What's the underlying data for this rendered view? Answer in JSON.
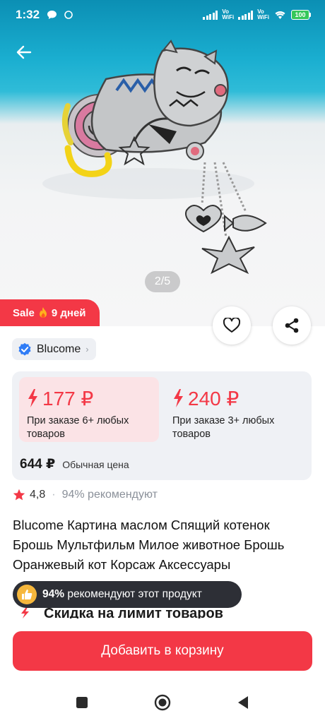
{
  "status": {
    "time": "1:32",
    "vowifi_top": "Vo",
    "vowifi_bottom": "WiFi",
    "battery": "100"
  },
  "gallery": {
    "pager": "2/5"
  },
  "sale": {
    "label": "Sale",
    "days": "9 дней"
  },
  "seller": {
    "name": "Blucome"
  },
  "prices": {
    "option1": {
      "price": "177 ₽",
      "note": "При заказе 6+ любых товаров"
    },
    "option2": {
      "price": "240 ₽",
      "note": "При заказе 3+ любых товаров"
    },
    "regular_amount": "644 ₽",
    "regular_label": "Обычная цена"
  },
  "rating": {
    "score": "4,8",
    "recommend": "94% рекомендуют"
  },
  "product": {
    "title": "Blucome Картина маслом Спящий котенок Брошь Мультфильм Милое животное Брошь Оранжевый кот Корсаж Аксессуары"
  },
  "recommend_pill": {
    "percent": "94%",
    "text": "рекомендуют этот продукт"
  },
  "hidden_section": {
    "title": "Скидка на лимит товаров"
  },
  "cta": {
    "label": "Добавить в корзину"
  },
  "colors": {
    "accent": "#f33846",
    "price_highlight_bg": "#fbe3e6",
    "card_bg": "#eff1f5",
    "pill_bg": "#2d2f36",
    "verified": "#2f7cf6"
  },
  "icons": {
    "back": "arrow-left-icon",
    "favorite": "heart-outline-icon",
    "share": "share-icon",
    "verified": "verified-badge-icon",
    "bolt": "lightning-icon",
    "fire": "fire-icon",
    "star": "star-icon",
    "thumb": "thumbs-up-icon"
  }
}
